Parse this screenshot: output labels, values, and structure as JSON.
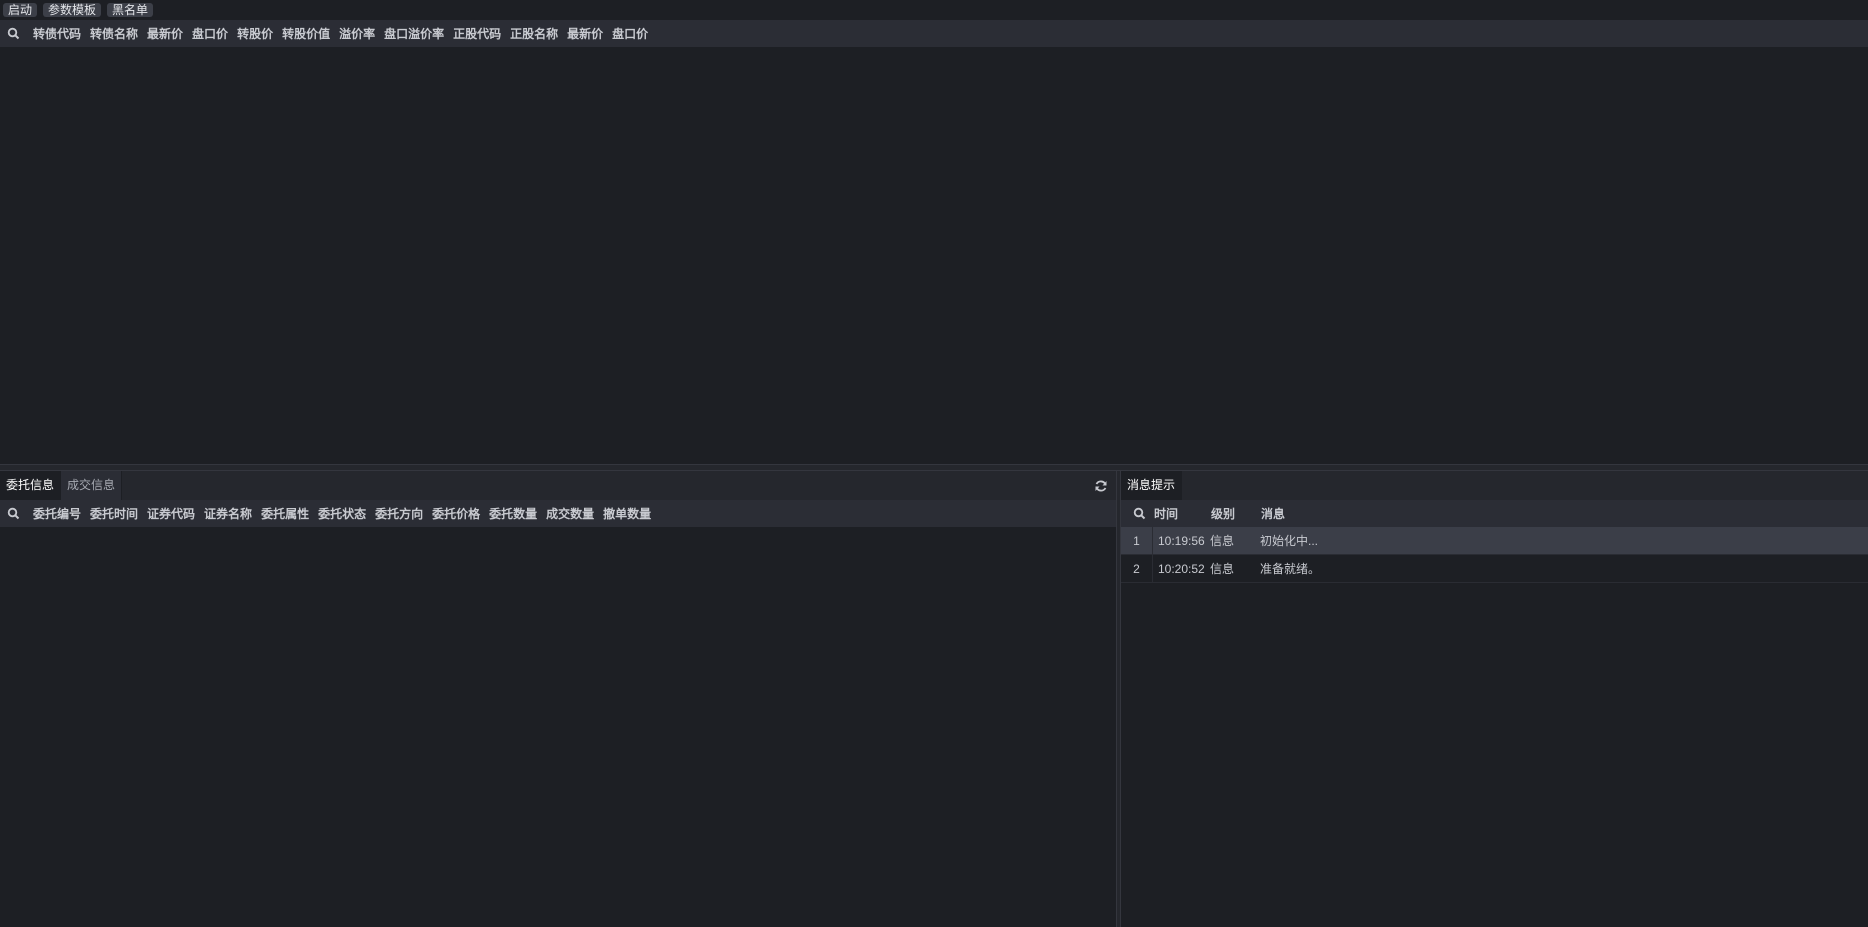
{
  "toolbar": {
    "start_label": "启动",
    "template_label": "参数模板",
    "blacklist_label": "黑名单"
  },
  "top_grid": {
    "columns": [
      "转债代码",
      "转债名称",
      "最新价",
      "盘口价",
      "转股价",
      "转股价值",
      "溢价率",
      "盘口溢价率",
      "正股代码",
      "正股名称",
      "最新价",
      "盘口价"
    ]
  },
  "left_panel": {
    "tabs": [
      {
        "label": "委托信息",
        "active": true
      },
      {
        "label": "成交信息",
        "active": false
      }
    ],
    "columns": [
      "委托编号",
      "委托时间",
      "证券代码",
      "证券名称",
      "委托属性",
      "委托状态",
      "委托方向",
      "委托价格",
      "委托数量",
      "成交数量",
      "撤单数量"
    ]
  },
  "right_panel": {
    "tab_label": "消息提示",
    "columns": {
      "time": "时间",
      "level": "级别",
      "message": "消息"
    },
    "rows": [
      {
        "idx": "1",
        "time": "10:19:56",
        "level": "信息",
        "message": "初始化中..."
      },
      {
        "idx": "2",
        "time": "10:20:52",
        "level": "信息",
        "message": "准备就绪。"
      }
    ]
  },
  "colors": {
    "background": "#1d1f24",
    "header_bg": "#2b2d35",
    "selected_row": "#3b3e48"
  }
}
